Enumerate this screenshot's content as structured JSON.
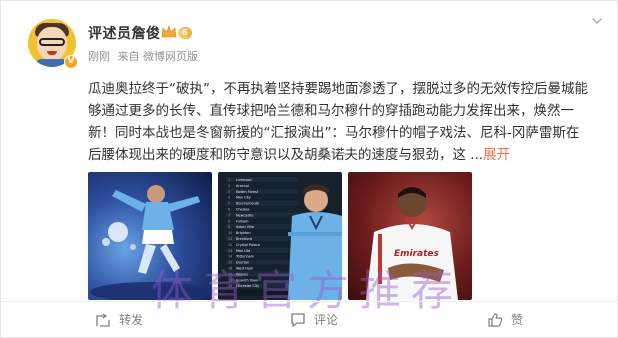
{
  "post": {
    "username": "评述员詹俊",
    "level": "6",
    "meta_time": "刚刚",
    "meta_source": "来自 微博网页版",
    "content": "瓜迪奥拉终于“破执”，不再执着坚持要踢地面渗透了，摆脱过多的无效传控后曼城能够通过更多的长传、直传球把哈兰德和马尔穆什的穿插跑动能力发挥出来，焕然一新！同时本战也是冬窗新援的“汇报演出”：马尔穆什的帽子戏法、尼科-冈萨雷斯在后腰体现出来的硬度和防守意识以及胡桑诺夫的速度与狠劲，这 ...",
    "expand_label": "展开",
    "images": [
      {
        "alt": "Manchester City player celebrating"
      },
      {
        "alt": "League table with Manchester City player"
      },
      {
        "alt": "Player in white Emirates shirt"
      }
    ]
  },
  "table": {
    "teams": [
      "Liverpool",
      "Arsenal",
      "Nottm Forest",
      "Man City",
      "Bournemouth",
      "Chelsea",
      "Newcastle",
      "Fulham",
      "Aston Villa",
      "Brighton",
      "Brentford",
      "Crystal Palace",
      "Man Utd",
      "Tottenham",
      "Everton",
      "West Ham",
      "Wolves",
      "Ipswich Town",
      "Leicester City"
    ]
  },
  "actions": {
    "repost": "转发",
    "comment": "评论",
    "like": "赞"
  },
  "watermark": "体育官方推荐",
  "colors": {
    "link": "#eb7350",
    "text": "#333333",
    "muted": "#939393",
    "watermark": "#9a5ac8"
  }
}
